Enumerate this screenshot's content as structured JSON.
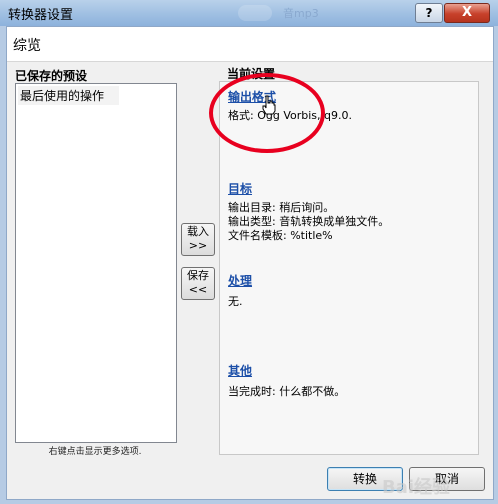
{
  "window": {
    "title": "转换器设置",
    "ghost_text": "音mp3",
    "help_label": "?",
    "close_label": "X"
  },
  "header": {
    "title": "综览"
  },
  "presets": {
    "label": "已保存的预设",
    "items": [
      "最后使用的操作"
    ],
    "hint": "右键点击显示更多选项."
  },
  "buttons": {
    "load_line1": "载入",
    "load_line2": ">>",
    "save_line1": "保存",
    "save_line2": "<<",
    "convert": "转换",
    "cancel": "取消"
  },
  "current": {
    "label": "当前设置",
    "output_format": {
      "title": "输出格式",
      "lines": [
        "格式: Ogg Vorbis, q9.0."
      ]
    },
    "target": {
      "title": "目标",
      "lines": [
        "输出目录: 稍后询问。",
        "输出类型: 音轨转换成单独文件。",
        "文件名模板: %title%"
      ]
    },
    "processing": {
      "title": "处理",
      "lines": [
        "无."
      ]
    },
    "other": {
      "title": "其他",
      "lines": [
        "当完成时: 什么都不做。"
      ]
    }
  },
  "watermark": "Bai经验",
  "colors": {
    "accent_link": "#1c4fa8",
    "highlight_circle": "#e8001f"
  }
}
